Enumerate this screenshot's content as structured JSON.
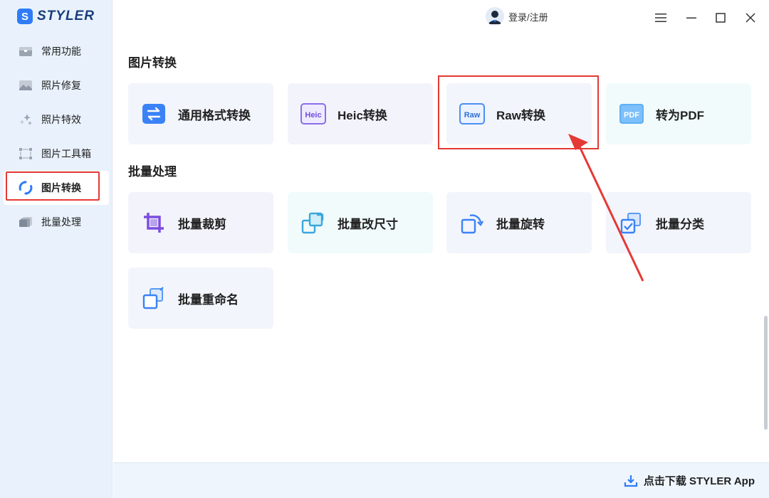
{
  "app": {
    "logo_letter": "S",
    "name": "STYLER"
  },
  "sidebar": {
    "items": [
      {
        "label": "常用功能",
        "icon": "common-functions-icon"
      },
      {
        "label": "照片修复",
        "icon": "photo-repair-icon"
      },
      {
        "label": "照片特效",
        "icon": "photo-effects-icon"
      },
      {
        "label": "图片工具箱",
        "icon": "toolbox-icon"
      },
      {
        "label": "图片转换",
        "icon": "convert-icon",
        "active": true
      },
      {
        "label": "批量处理",
        "icon": "batch-icon"
      }
    ]
  },
  "header": {
    "login_label": "登录/注册"
  },
  "sections": {
    "convert": {
      "title": "图片转换",
      "cards": [
        {
          "label": "通用格式转换"
        },
        {
          "label": "Heic转换",
          "badge": "Heic"
        },
        {
          "label": "Raw转换",
          "badge": "Raw"
        },
        {
          "label": "转为PDF",
          "badge": "PDF"
        }
      ]
    },
    "batch": {
      "title": "批量处理",
      "cards": [
        {
          "label": "批量裁剪"
        },
        {
          "label": "批量改尺寸"
        },
        {
          "label": "批量旋转"
        },
        {
          "label": "批量分类"
        },
        {
          "label": "批量重命名"
        }
      ]
    }
  },
  "footer": {
    "download_label": "点击下载 STYLER App"
  },
  "colors": {
    "accent": "#2f7cf6",
    "highlight": "#e53935"
  }
}
